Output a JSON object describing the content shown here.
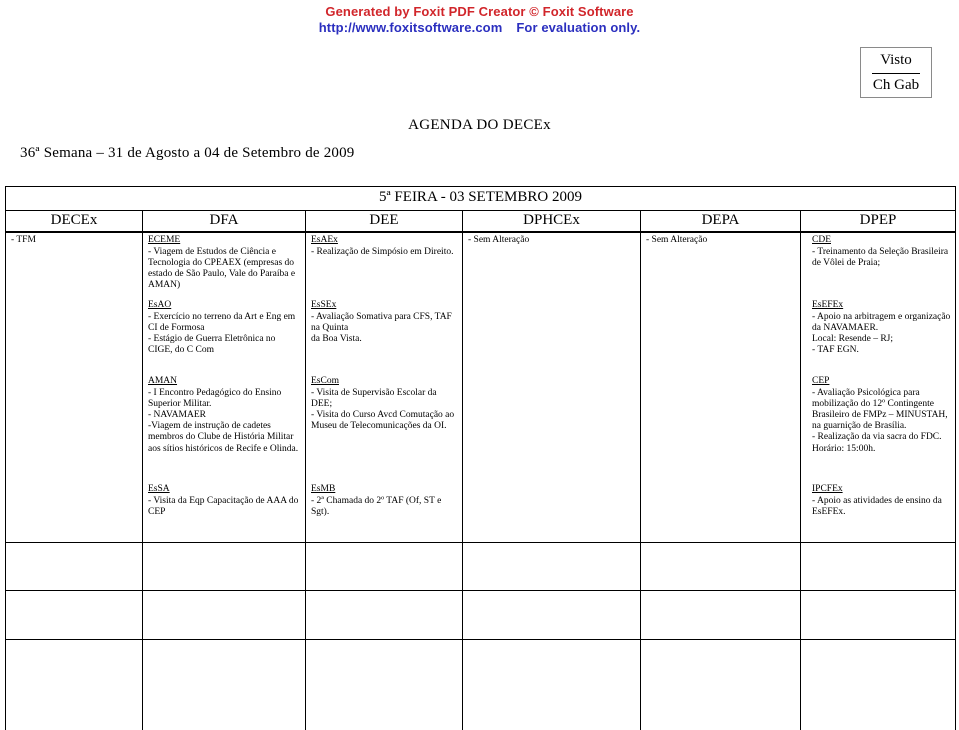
{
  "watermark": {
    "line1": "Generated by Foxit PDF Creator © Foxit Software",
    "line2_url": "http://www.foxitsoftware.com",
    "line2_note": "For evaluation only.",
    "color_line1": "#d1262b",
    "color_line2": "#2b2fbf"
  },
  "visto": {
    "label": "Visto",
    "signature": "Ch Gab"
  },
  "title": "AGENDA DO DECEx",
  "week_line": "36ª Semana – 31 de Agosto a 04 de Setembro de 2009",
  "table": {
    "day_header": "5ª FEIRA - 03 SETEMBRO 2009",
    "columns": [
      "DECEx",
      "DFA",
      "DEE",
      "DPHCEx",
      "DEPA",
      "DPEP"
    ],
    "rows": [
      {
        "decex": "- TFM",
        "dfa_org": "ECEME",
        "dfa_text": "- Viagem  de Estudos de Ciência e Tecnologia do CPEAEX (empresas do estado de São Paulo, Vale do Paraíba e AMAN)",
        "dee_org": "EsAEx",
        "dee_text": "- Realização de Simpósio em Direito.",
        "dphcex": "- Sem Alteração",
        "depa": "- Sem Alteração",
        "dpep_org": "CDE",
        "dpep_text": "- Treinamento da Seleção Brasileira de Vôlei de Praia;"
      },
      {
        "decex": "",
        "dfa_org": "EsAO",
        "dfa_text": "- Exercício no terreno da Art e Eng em CI de Formosa\n- Estágio de Guerra Eletrônica no CIGE,  do C Com",
        "dee_org": "EsSEx",
        "dee_text": "- Avaliação Somativa para CFS, TAF na Quinta\nda Boa Vista.",
        "dphcex": "",
        "depa": "",
        "dpep_org": "EsEFEx",
        "dpep_text": "- Apoio na arbitragem e organização da NAVAMAER.\nLocal: Resende – RJ;\n- TAF EGN."
      },
      {
        "decex": "",
        "dfa_org": "AMAN",
        "dfa_text": "- I Encontro Pedagógico do Ensino Superior Militar.\n- NAVAMAER\n-Viagem de instrução de cadetes membros do Clube de História Militar aos sítios históricos de Recife e Olinda.",
        "dee_org": "EsCom",
        "dee_text": "- Visita de Supervisão Escolar da DEE;\n- Visita do Curso Avcd Comutação ao Museu de Telecomunicações da OI.",
        "dphcex": "",
        "depa": "",
        "dpep_org": "CEP",
        "dpep_text": "- Avaliação Psicológica para mobilização do 12º Contingente Brasileiro de FMPz – MINUSTAH, na  guarnição de Brasília.\n- Realização da via sacra do FDC. Horário: 15:00h."
      },
      {
        "decex": "",
        "dfa_org": "EsSA",
        "dfa_text": "- Visita da Eqp  Capacitação de AAA do CEP",
        "dee_org": "EsMB",
        "dee_text": "- 2ª Chamada do 2º TAF (Of, ST e Sgt).",
        "dphcex": "",
        "depa": "",
        "dpep_org": "IPCFEx",
        "dpep_text": "- Apoio as atividades de ensino da EsEFEx."
      }
    ]
  }
}
